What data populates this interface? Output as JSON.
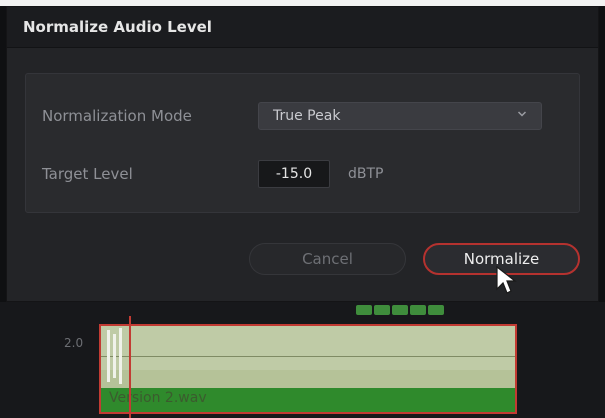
{
  "dialog": {
    "title": "Normalize Audio Level",
    "normalization_mode_label": "Normalization Mode",
    "normalization_mode_value": "True Peak",
    "target_level_label": "Target Level",
    "target_level_value": "-15.0",
    "target_level_unit": "dBTP",
    "cancel_label": "Cancel",
    "normalize_label": "Normalize"
  },
  "timeline": {
    "track_number": "2.0",
    "clip_name": "Version 2.wav"
  },
  "colors": {
    "accent": "#b5322f",
    "clip_green": "#2f8a2c"
  },
  "icons": {
    "dropdown": "chevron-down-icon",
    "pointer": "mouse-pointer-icon"
  }
}
